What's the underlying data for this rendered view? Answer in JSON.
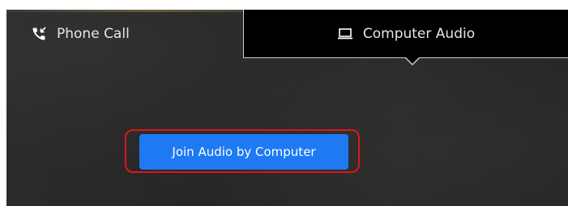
{
  "tabs": {
    "phone": {
      "label": "Phone Call",
      "icon": "phone-icon"
    },
    "computer": {
      "label": "Computer Audio",
      "icon": "laptop-icon",
      "selected": true
    }
  },
  "main": {
    "join_button_label": "Join Audio by Computer",
    "button_color": "#1d7af2",
    "highlight_color": "#e0141e"
  }
}
